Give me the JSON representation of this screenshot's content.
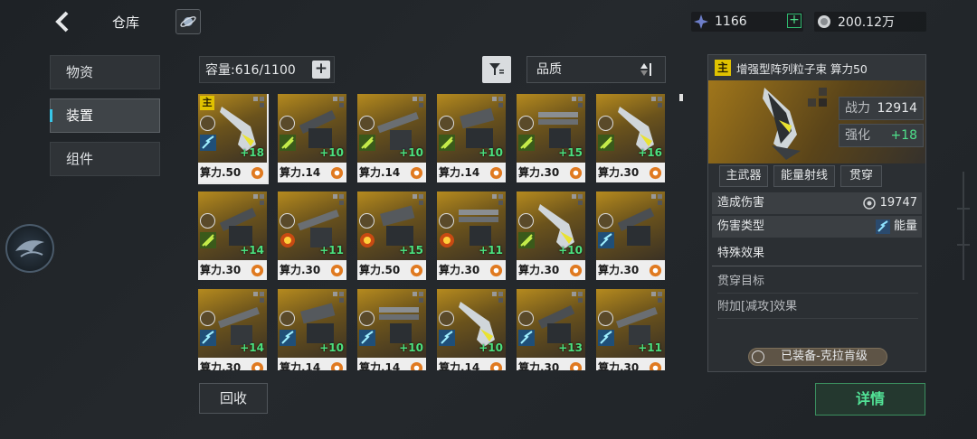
{
  "header": {
    "title": "仓库",
    "currency_1": "1166",
    "currency_2": "200.12万",
    "currency_1_plus": "+"
  },
  "nav": {
    "items": [
      {
        "label": "物资",
        "active": false
      },
      {
        "label": "装置",
        "active": true
      },
      {
        "label": "组件",
        "active": false
      }
    ]
  },
  "toolbar": {
    "capacity": "容量:616/1100",
    "capacity_plus": "+",
    "sort_label": "品质"
  },
  "items": [
    {
      "label": "算力.50",
      "plus": "+18",
      "main": "主",
      "elem": "energy",
      "selected": true
    },
    {
      "label": "算力.14",
      "plus": "+10",
      "elem": "green"
    },
    {
      "label": "算力.14",
      "plus": "+10",
      "elem": "green"
    },
    {
      "label": "算力.14",
      "plus": "+10",
      "elem": "green"
    },
    {
      "label": "算力.30",
      "plus": "+15",
      "elem": "green"
    },
    {
      "label": "算力.30",
      "plus": "+16",
      "elem": "green"
    },
    {
      "label": "算力.30",
      "plus": "+14",
      "elem": "green"
    },
    {
      "label": "算力.30",
      "plus": "+11",
      "elem": "fire"
    },
    {
      "label": "算力.50",
      "plus": "+15",
      "elem": "fire"
    },
    {
      "label": "算力.30",
      "plus": "+11",
      "elem": "fire"
    },
    {
      "label": "算力.30",
      "plus": "+10",
      "elem": "green"
    },
    {
      "label": "算力.30",
      "plus": "",
      "elem": "energy"
    },
    {
      "label": "算力.30",
      "plus": "+14",
      "elem": "energy"
    },
    {
      "label": "算力.14",
      "plus": "+10",
      "elem": "energy"
    },
    {
      "label": "算力.14",
      "plus": "+10",
      "elem": "energy"
    },
    {
      "label": "算力.14",
      "plus": "+10",
      "elem": "energy"
    },
    {
      "label": "算力.30",
      "plus": "+13",
      "elem": "energy"
    },
    {
      "label": "算力.30",
      "plus": "+11",
      "elem": "energy"
    }
  ],
  "recycle_label": "回收",
  "detail": {
    "main_tag": "主",
    "name": "增强型阵列粒子束  算力50",
    "power_label": "战力",
    "power_value": "12914",
    "enhance_label": "强化",
    "enhance_value": "+18",
    "tags": [
      "主武器",
      "能量射线",
      "贯穿"
    ],
    "damage_label": "造成伤害",
    "damage_value": "19747",
    "damage_type_label": "伤害类型",
    "damage_type_value": "能量",
    "special_title": "特殊效果",
    "effects": [
      "贯穿目标",
      "附加[减攻]效果"
    ],
    "equipped": "已装备-克拉肯级",
    "detail_button": "详情"
  },
  "colors": {
    "accent_green": "#4fe08a",
    "main_tag": "#e0c200",
    "card_bg": "#b58a1e"
  }
}
